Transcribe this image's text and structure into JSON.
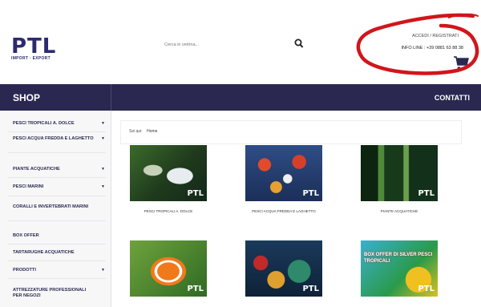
{
  "header": {
    "logo_main": "PTL",
    "logo_sub": "IMPORT · EXPORT",
    "search_placeholder": "Cerca in vetrina..."
  },
  "account": {
    "login": "ACCEDI / REGISTRATI",
    "info": "INFO LINE : +39 0881 63 88 38"
  },
  "nav": {
    "shop": "SHOP",
    "contatti": "CONTATTI"
  },
  "sidebar": {
    "items": [
      {
        "label": "PESCI TROPICALI A. DOLCE",
        "has_submenu": true
      },
      {
        "label": "PESCI ACQUA FREDDA E LAGHETTO",
        "has_submenu": true
      },
      {
        "label": "PIANTE ACQUATICHE",
        "has_submenu": true
      },
      {
        "label": "PESCI MARINI",
        "has_submenu": true
      },
      {
        "label": "CORALLI E INVERTEBRATI MARINI",
        "has_submenu": false
      },
      {
        "label": "BOX OFFER",
        "has_submenu": false
      },
      {
        "label": "TARTARUGHE ACQUATICHE",
        "has_submenu": false
      },
      {
        "label": "PRODOTTI",
        "has_submenu": true
      },
      {
        "label": "ATTREZZATURE PROFESSIONALI PER NEGOZI",
        "has_submenu": false
      }
    ]
  },
  "breadcrumb": {
    "prefix": "Sei qui:",
    "current": "Home"
  },
  "products": [
    {
      "caption": "PESCI TROPICALI A. DOLCE",
      "watermark": "PTL"
    },
    {
      "caption": "PESCI ACQUA FREDDA E LAGHETTO",
      "watermark": "PTL"
    },
    {
      "caption": "PIANTE ACQUATICHE",
      "watermark": "PTL"
    },
    {
      "caption": "",
      "watermark": "PTL"
    },
    {
      "caption": "",
      "watermark": "PTL"
    },
    {
      "caption": "",
      "watermark": "PTL",
      "badge": "BOX OFFER DI SILVER PESCI TROPICALI"
    }
  ],
  "colors": {
    "brand_navy": "#2a2850",
    "annotation_red": "#d0161c"
  },
  "icons": {
    "search": "search-icon",
    "cart": "cart-icon",
    "submenu": "chevron-down-icon"
  }
}
